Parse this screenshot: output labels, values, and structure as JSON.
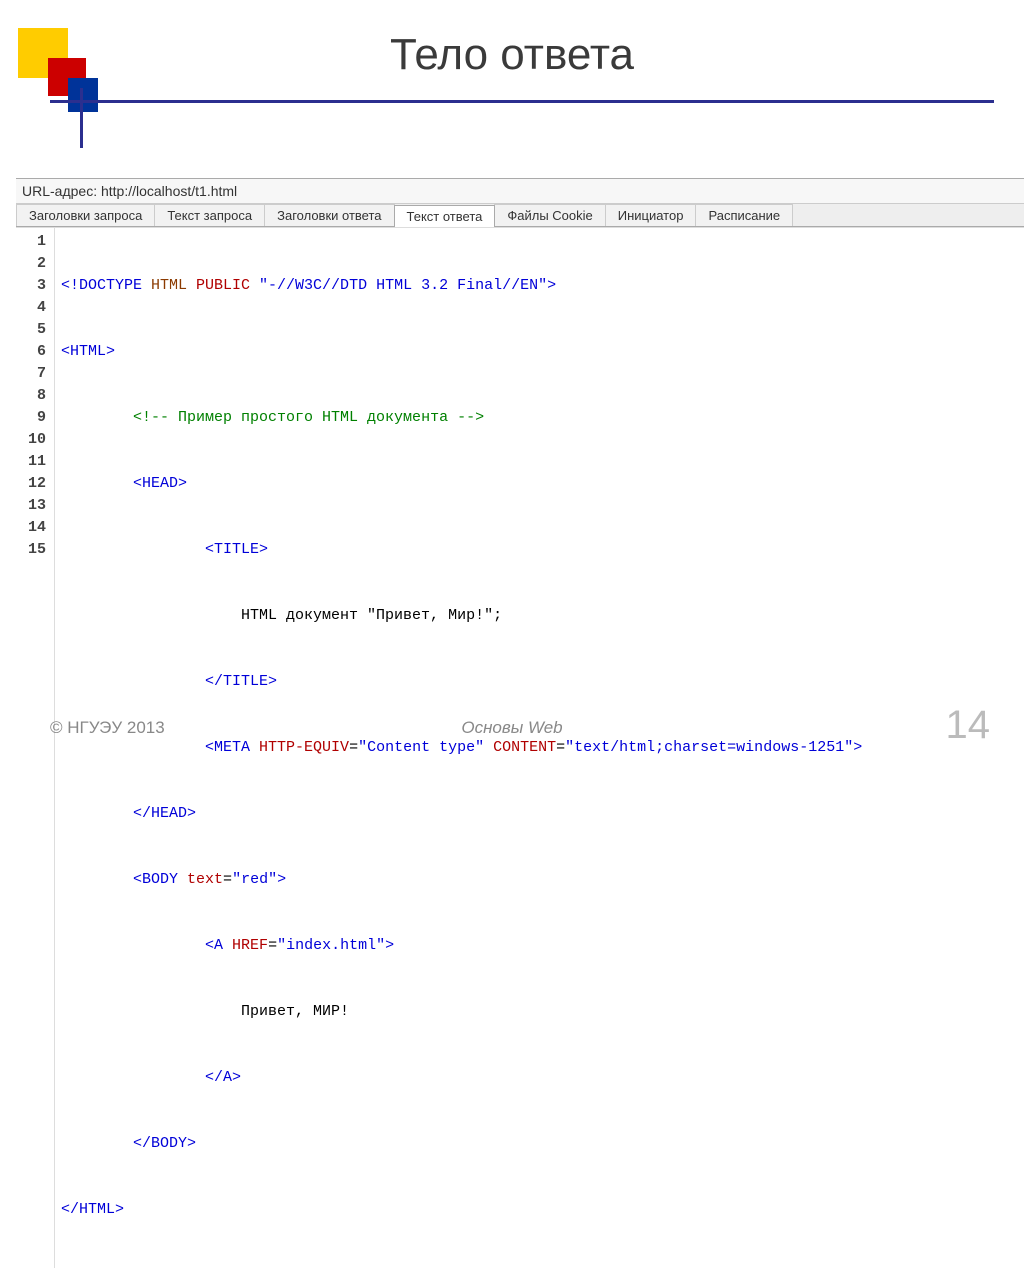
{
  "slide": {
    "title": "Тело ответа",
    "footer_left": "© НГУЭУ 2013",
    "footer_center": "Основы Web",
    "page_number": "14"
  },
  "panel": {
    "url_label": "URL-адрес: http://localhost/t1.html",
    "tabs": [
      "Заголовки запроса",
      "Текст запроса",
      "Заголовки ответа",
      "Текст ответа",
      "Файлы Cookie",
      "Инициатор",
      "Расписание"
    ],
    "active_tab_index": 3,
    "gutter": [
      "1",
      "2",
      "3",
      "4",
      "5",
      "6",
      "7",
      "8",
      "9",
      "10",
      "11",
      "12",
      "13",
      "14",
      "15"
    ],
    "code": {
      "l1": {
        "a": "<!DOCTYPE",
        "b": " HTML",
        "c": " PUBLIC",
        "d": " \"-//W3C//DTD HTML 3.2 Final//EN\"",
        "e": ">"
      },
      "l2": {
        "a": "<HTML>"
      },
      "l3": {
        "pad": "        ",
        "a": "<!-- Пример простого HTML документа -->"
      },
      "l4": {
        "pad": "        ",
        "a": "<HEAD>"
      },
      "l5": {
        "pad": "                ",
        "a": "<TITLE>"
      },
      "l6": {
        "pad": "                    ",
        "a": "HTML документ \"Привет, Мир!\";"
      },
      "l7": {
        "pad": "                ",
        "a": "</TITLE>"
      },
      "l8": {
        "pad": "                ",
        "a": "<META",
        "b": " HTTP-EQUIV",
        "c": "=",
        "d": "\"Content type\"",
        "e": " CONTENT",
        "f": "=",
        "g": "\"text/html;charset=windows-1251\"",
        "h": ">"
      },
      "l9": {
        "pad": "        ",
        "a": "</HEAD>"
      },
      "l10": {
        "pad": "        ",
        "a": "<BODY",
        "b": " text",
        "c": "=",
        "d": "\"red\"",
        "e": ">"
      },
      "l11": {
        "pad": "                ",
        "a": "<A",
        "b": " HREF",
        "c": "=",
        "d": "\"index.html\"",
        "e": ">"
      },
      "l12": {
        "pad": "                    ",
        "a": "Привет, МИР!"
      },
      "l13": {
        "pad": "                ",
        "a": "</A>"
      },
      "l14": {
        "pad": "        ",
        "a": "</BODY>"
      },
      "l15": {
        "a": "</HTML>"
      }
    }
  }
}
